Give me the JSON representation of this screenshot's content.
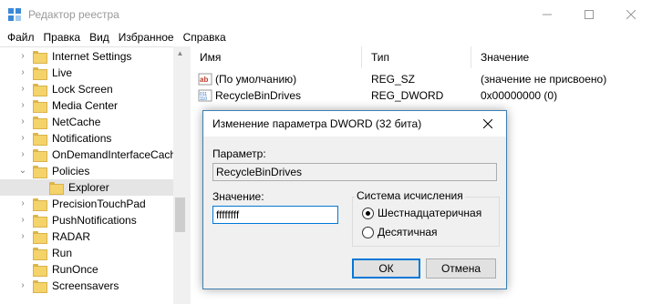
{
  "window": {
    "title": "Редактор реестра"
  },
  "menu": [
    "Файл",
    "Правка",
    "Вид",
    "Избранное",
    "Справка"
  ],
  "tree": {
    "items": [
      {
        "label": "Internet Settings",
        "chevron": "›",
        "indent": 0
      },
      {
        "label": "Live",
        "chevron": "›",
        "indent": 0
      },
      {
        "label": "Lock Screen",
        "chevron": "›",
        "indent": 0
      },
      {
        "label": "Media Center",
        "chevron": "›",
        "indent": 0
      },
      {
        "label": "NetCache",
        "chevron": "›",
        "indent": 0
      },
      {
        "label": "Notifications",
        "chevron": "›",
        "indent": 0
      },
      {
        "label": "OnDemandInterfaceCach",
        "chevron": "›",
        "indent": 0
      },
      {
        "label": "Policies",
        "chevron": "⌄",
        "indent": 0
      },
      {
        "label": "Explorer",
        "chevron": "",
        "indent": 1
      },
      {
        "label": "PrecisionTouchPad",
        "chevron": "›",
        "indent": 0
      },
      {
        "label": "PushNotifications",
        "chevron": "›",
        "indent": 0
      },
      {
        "label": "RADAR",
        "chevron": "›",
        "indent": 0
      },
      {
        "label": "Run",
        "chevron": "",
        "indent": 0
      },
      {
        "label": "RunOnce",
        "chevron": "",
        "indent": 0
      },
      {
        "label": "Screensavers",
        "chevron": "›",
        "indent": 0
      }
    ]
  },
  "values_pane": {
    "headers": {
      "name": "Имя",
      "type": "Тип",
      "data": "Значение"
    },
    "rows": [
      {
        "icon": "string-value-icon",
        "name": "(По умолчанию)",
        "type": "REG_SZ",
        "data": "(значение не присвоено)"
      },
      {
        "icon": "dword-value-icon",
        "name": "RecycleBinDrives",
        "type": "REG_DWORD",
        "data": "0x00000000 (0)"
      }
    ]
  },
  "dialog": {
    "title": "Изменение параметра DWORD (32 бита)",
    "param_label": "Параметр:",
    "param_value": "RecycleBinDrives",
    "value_label": "Значение:",
    "value_input": "ffffffff",
    "base_group": "Система исчисления",
    "radio_hex": "Шестнадцатеричная",
    "radio_dec": "Десятичная",
    "selected_base": "hex",
    "ok": "ОК",
    "cancel": "Отмена"
  }
}
